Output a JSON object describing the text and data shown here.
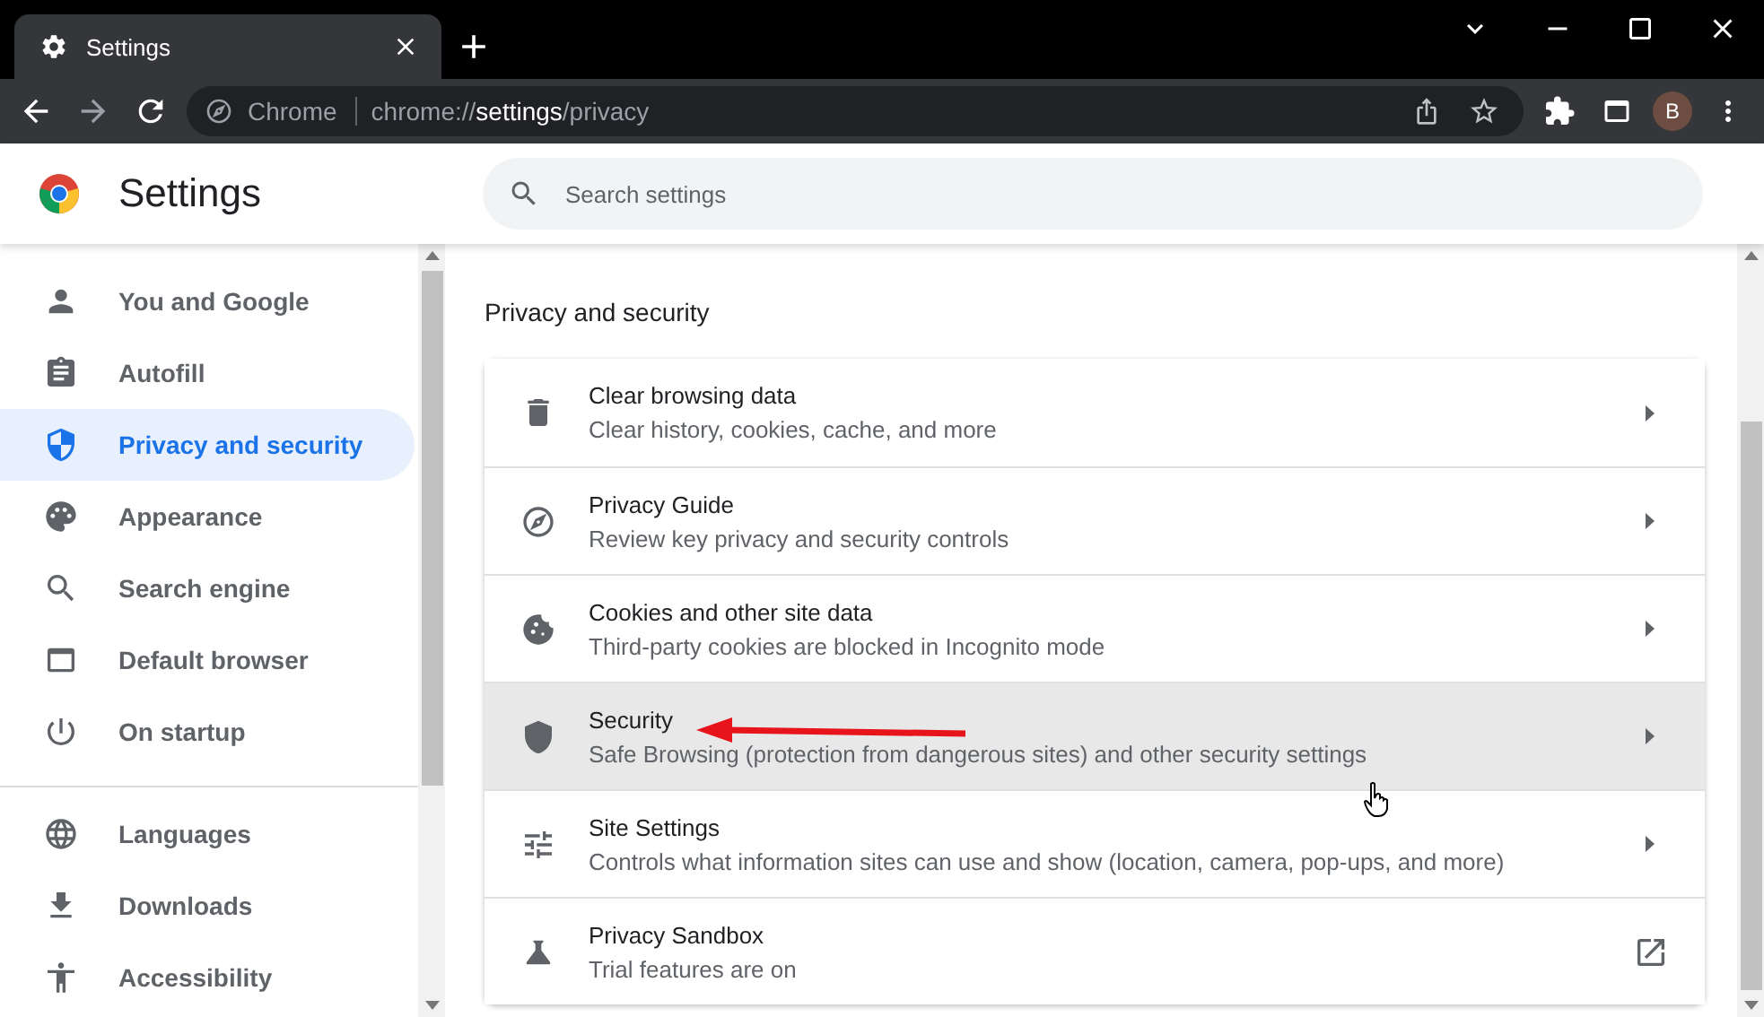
{
  "tab": {
    "title": "Settings"
  },
  "toolbar": {
    "chip": "Chrome",
    "url": "chrome://**settings**/privacy",
    "avatar": "B"
  },
  "header": {
    "title": "Settings",
    "search": {
      "placeholder": "Search settings"
    }
  },
  "sidebar": {
    "groups": [
      {
        "items": [
          {
            "label": "You and Google",
            "selected": false
          },
          {
            "label": "Autofill",
            "selected": false
          },
          {
            "label": "Privacy and security",
            "selected": true
          },
          {
            "label": "Appearance",
            "selected": false
          },
          {
            "label": "Search engine",
            "selected": false
          },
          {
            "label": "Default browser",
            "selected": false
          },
          {
            "label": "On startup",
            "selected": false
          }
        ]
      },
      {
        "items": [
          {
            "label": "Languages",
            "selected": false
          },
          {
            "label": "Downloads",
            "selected": false
          },
          {
            "label": "Accessibility",
            "selected": false
          }
        ]
      }
    ]
  },
  "section": {
    "title": "Privacy and security",
    "rows": [
      {
        "title": "Clear browsing data",
        "description": "Clear history, cookies, cache, and more",
        "kind": "arrow",
        "hovered": false
      },
      {
        "title": "Privacy Guide",
        "description": "Review key privacy and security controls",
        "kind": "arrow",
        "hovered": false
      },
      {
        "title": "Cookies and other site data",
        "description": "Third-party cookies are blocked in Incognito mode",
        "kind": "arrow",
        "hovered": false
      },
      {
        "title": "Security",
        "description": "Safe Browsing (protection from dangerous sites) and other security settings",
        "kind": "arrow",
        "hovered": true
      },
      {
        "title": "Site Settings",
        "description": "Controls what information sites can use and show (location, camera, pop-ups, and more)",
        "kind": "arrow",
        "hovered": false
      },
      {
        "title": "Privacy Sandbox",
        "description": "Trial features are on",
        "kind": "external",
        "hovered": false
      }
    ]
  }
}
